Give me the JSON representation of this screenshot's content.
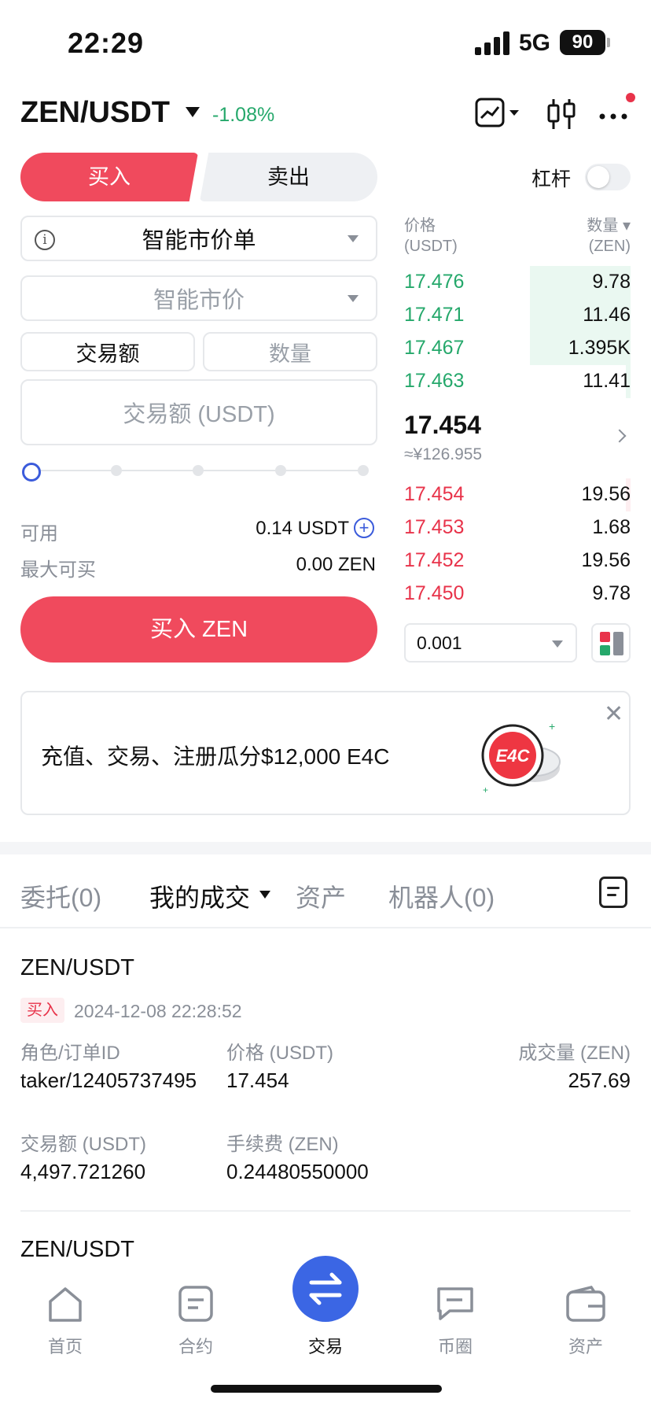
{
  "status_bar": {
    "time": "22:29",
    "network": "5G",
    "battery": "90"
  },
  "header": {
    "pair": "ZEN/USDT",
    "change": "-1.08%"
  },
  "trade_tabs": {
    "buy": "买入",
    "sell": "卖出"
  },
  "leverage": {
    "label": "杠杆",
    "enabled": false
  },
  "order_type": {
    "value": "智能市价单"
  },
  "price_mode": {
    "placeholder": "智能市价"
  },
  "amount_mode": {
    "options": [
      "交易额",
      "数量"
    ],
    "selected": "交易额"
  },
  "amount_input": {
    "placeholder": "交易额 (USDT)"
  },
  "slider": {
    "value_percent": 0
  },
  "balance": {
    "available_label": "可用",
    "available_value": "0.14 USDT",
    "max_label": "最大可买",
    "max_value": "0.00 ZEN"
  },
  "buy_button": {
    "label": "买入 ZEN"
  },
  "orderbook": {
    "price_header": "价格",
    "price_unit": "(USDT)",
    "qty_header": "数量 ▾",
    "qty_unit": "(ZEN)",
    "asks": [
      {
        "price": "17.476",
        "qty": "9.78"
      },
      {
        "price": "17.471",
        "qty": "11.46"
      },
      {
        "price": "17.467",
        "qty": "1.395K"
      },
      {
        "price": "17.463",
        "qty": "11.41"
      }
    ],
    "last_price": "17.454",
    "last_price_cny": "≈¥126.955",
    "bids": [
      {
        "price": "17.454",
        "qty": "19.56"
      },
      {
        "price": "17.453",
        "qty": "1.68"
      },
      {
        "price": "17.452",
        "qty": "19.56"
      },
      {
        "price": "17.450",
        "qty": "9.78"
      }
    ],
    "precision": "0.001"
  },
  "promo": {
    "text": "充值、交易、注册瓜分$12,000 E4C",
    "art_text": "E4C"
  },
  "order_tabs": [
    {
      "label": "委托(0)"
    },
    {
      "label": "我的成交"
    },
    {
      "label": "资产"
    },
    {
      "label": "机器人(0)"
    }
  ],
  "trades": [
    {
      "pair": "ZEN/USDT",
      "side": "买入",
      "time": "2024-12-08 22:28:52",
      "role_label": "角色/订单ID",
      "role_value": "taker/12405737495",
      "price_label": "价格 (USDT)",
      "price_value": "17.454",
      "volume_label": "成交量 (ZEN)",
      "volume_value": "257.69",
      "amount_label": "交易额 (USDT)",
      "amount_value": "4,497.721260",
      "fee_label": "手续费 (ZEN)",
      "fee_value": "0.24480550000"
    },
    {
      "pair": "ZEN/USDT"
    }
  ],
  "bottom_nav": [
    {
      "label": "首页",
      "icon": "home-icon"
    },
    {
      "label": "合约",
      "icon": "contract-icon"
    },
    {
      "label": "交易",
      "icon": "swap-icon"
    },
    {
      "label": "币圈",
      "icon": "chat-icon"
    },
    {
      "label": "资产",
      "icon": "wallet-icon"
    }
  ],
  "colors": {
    "buy": "#f04a5d",
    "ask_green": "#25a86b",
    "bid_red": "#e8334a",
    "accent": "#3b66e4"
  }
}
